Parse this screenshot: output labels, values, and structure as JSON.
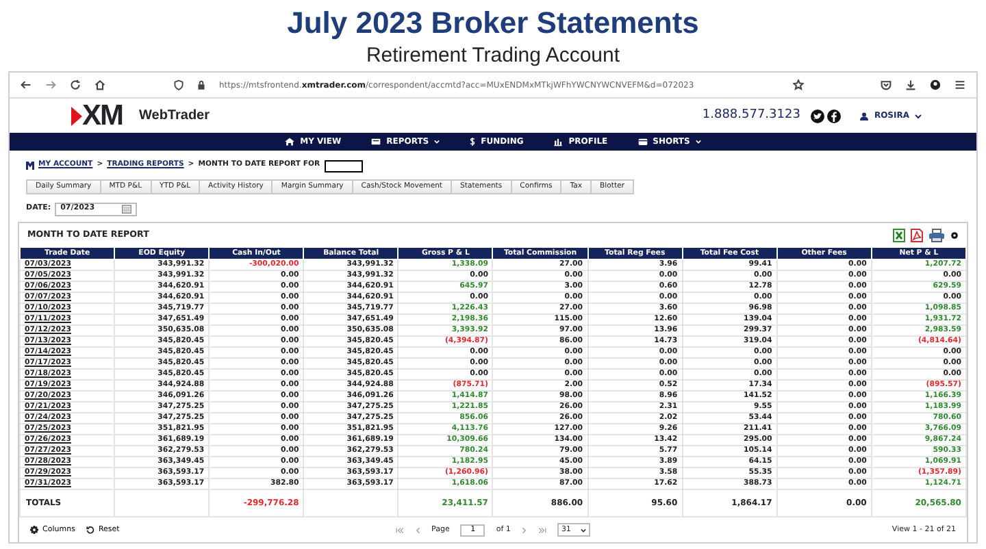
{
  "page": {
    "title": "July 2023 Broker Statements",
    "subtitle": "Retirement Trading Account"
  },
  "browser": {
    "url": "https://mtsfrontend.**xmtrader.com**/correspondent/accmtd?acc=MUxENDMxMTkjWFhYWCNYWCNVEFM&d=072023"
  },
  "header": {
    "logo": "XM",
    "brand": "WebTrader",
    "phone": "1.888.577.3123",
    "user": "ROSIRA"
  },
  "nav": [
    {
      "label": "MY VIEW",
      "dropdown": false
    },
    {
      "label": "REPORTS",
      "dropdown": true
    },
    {
      "label": "FUNDING",
      "dropdown": false
    },
    {
      "label": "PROFILE",
      "dropdown": false
    },
    {
      "label": "SHORTS",
      "dropdown": true
    }
  ],
  "breadcrumb": [
    {
      "kind": "link",
      "text": "MY ACCOUNT"
    },
    {
      "kind": "sep",
      "text": ">"
    },
    {
      "kind": "link",
      "text": "TRADING REPORTS"
    },
    {
      "kind": "sep",
      "text": ">"
    },
    {
      "kind": "current",
      "text": "MONTH TO DATE REPORT FOR"
    }
  ],
  "report_tabs": [
    "Daily Summary",
    "MTD P&L",
    "YTD P&L",
    "Activity History",
    "Margin Summary",
    "Cash/Stock Movement",
    "Statements",
    "Confirms",
    "Tax",
    "Blotter"
  ],
  "date": {
    "label": "DATE:",
    "value": "07/2023"
  },
  "report": {
    "title": "MONTH TO DATE REPORT",
    "columns": [
      "Trade Date",
      "EOD Equity",
      "Cash In/Out",
      "Balance Total",
      "Gross P & L",
      "Total Commission",
      "Total Reg Fees",
      "Total Fee Cost",
      "Other Fees",
      "Net P & L"
    ],
    "rows": [
      {
        "cells": [
          "07/03/2023",
          "343,991.32",
          "-300,020.00",
          "343,991.32",
          "1,338.09",
          "27.00",
          "3.96",
          "99.41",
          "0.00",
          "1,207.72"
        ],
        "cash_negative": true,
        "pnl_gain": true,
        "pnl_loss": false
      },
      {
        "cells": [
          "07/05/2023",
          "343,991.32",
          "0.00",
          "343,991.32",
          "0.00",
          "0.00",
          "0.00",
          "0.00",
          "0.00",
          "0.00"
        ],
        "cash_negative": false,
        "pnl_gain": false,
        "pnl_loss": false
      },
      {
        "cells": [
          "07/06/2023",
          "344,620.91",
          "0.00",
          "344,620.91",
          "645.97",
          "3.00",
          "0.60",
          "12.78",
          "0.00",
          "629.59"
        ],
        "cash_negative": false,
        "pnl_gain": true,
        "pnl_loss": false
      },
      {
        "cells": [
          "07/07/2023",
          "344,620.91",
          "0.00",
          "344,620.91",
          "0.00",
          "0.00",
          "0.00",
          "0.00",
          "0.00",
          "0.00"
        ],
        "cash_negative": false,
        "pnl_gain": false,
        "pnl_loss": false
      },
      {
        "cells": [
          "07/10/2023",
          "345,719.77",
          "0.00",
          "345,719.77",
          "1,226.43",
          "27.00",
          "3.60",
          "96.98",
          "0.00",
          "1,098.85"
        ],
        "cash_negative": false,
        "pnl_gain": true,
        "pnl_loss": false
      },
      {
        "cells": [
          "07/11/2023",
          "347,651.49",
          "0.00",
          "347,651.49",
          "2,198.36",
          "115.00",
          "12.60",
          "139.04",
          "0.00",
          "1,931.72"
        ],
        "cash_negative": false,
        "pnl_gain": true,
        "pnl_loss": false
      },
      {
        "cells": [
          "07/12/2023",
          "350,635.08",
          "0.00",
          "350,635.08",
          "3,393.92",
          "97.00",
          "13.96",
          "299.37",
          "0.00",
          "2,983.59"
        ],
        "cash_negative": false,
        "pnl_gain": true,
        "pnl_loss": false
      },
      {
        "cells": [
          "07/13/2023",
          "345,820.45",
          "0.00",
          "345,820.45",
          "(4,394.87)",
          "86.00",
          "14.73",
          "319.04",
          "0.00",
          "(4,814.64)"
        ],
        "cash_negative": false,
        "pnl_gain": false,
        "pnl_loss": true
      },
      {
        "cells": [
          "07/14/2023",
          "345,820.45",
          "0.00",
          "345,820.45",
          "0.00",
          "0.00",
          "0.00",
          "0.00",
          "0.00",
          "0.00"
        ],
        "cash_negative": false,
        "pnl_gain": false,
        "pnl_loss": false
      },
      {
        "cells": [
          "07/17/2023",
          "345,820.45",
          "0.00",
          "345,820.45",
          "0.00",
          "0.00",
          "0.00",
          "0.00",
          "0.00",
          "0.00"
        ],
        "cash_negative": false,
        "pnl_gain": false,
        "pnl_loss": false
      },
      {
        "cells": [
          "07/18/2023",
          "345,820.45",
          "0.00",
          "345,820.45",
          "0.00",
          "0.00",
          "0.00",
          "0.00",
          "0.00",
          "0.00"
        ],
        "cash_negative": false,
        "pnl_gain": false,
        "pnl_loss": false
      },
      {
        "cells": [
          "07/19/2023",
          "344,924.88",
          "0.00",
          "344,924.88",
          "(875.71)",
          "2.00",
          "0.52",
          "17.34",
          "0.00",
          "(895.57)"
        ],
        "cash_negative": false,
        "pnl_gain": false,
        "pnl_loss": true
      },
      {
        "cells": [
          "07/20/2023",
          "346,091.26",
          "0.00",
          "346,091.26",
          "1,414.87",
          "98.00",
          "8.96",
          "141.52",
          "0.00",
          "1,166.39"
        ],
        "cash_negative": false,
        "pnl_gain": true,
        "pnl_loss": false
      },
      {
        "cells": [
          "07/21/2023",
          "347,275.25",
          "0.00",
          "347,275.25",
          "1,221.85",
          "26.00",
          "2.31",
          "9.55",
          "0.00",
          "1,183.99"
        ],
        "cash_negative": false,
        "pnl_gain": true,
        "pnl_loss": false
      },
      {
        "cells": [
          "07/24/2023",
          "347,275.25",
          "0.00",
          "347,275.25",
          "856.06",
          "26.00",
          "2.02",
          "53.44",
          "0.00",
          "780.60"
        ],
        "cash_negative": false,
        "pnl_gain": true,
        "pnl_loss": false
      },
      {
        "cells": [
          "07/25/2023",
          "351,821.95",
          "0.00",
          "351,821.95",
          "4,113.76",
          "127.00",
          "9.26",
          "211.41",
          "0.00",
          "3,766.09"
        ],
        "cash_negative": false,
        "pnl_gain": true,
        "pnl_loss": false
      },
      {
        "cells": [
          "07/26/2023",
          "361,689.19",
          "0.00",
          "361,689.19",
          "10,309.66",
          "134.00",
          "13.42",
          "295.00",
          "0.00",
          "9,867.24"
        ],
        "cash_negative": false,
        "pnl_gain": true,
        "pnl_loss": false
      },
      {
        "cells": [
          "07/27/2023",
          "362,279.53",
          "0.00",
          "362,279.53",
          "780.24",
          "79.00",
          "5.77",
          "105.14",
          "0.00",
          "590.33"
        ],
        "cash_negative": false,
        "pnl_gain": true,
        "pnl_loss": false
      },
      {
        "cells": [
          "07/28/2023",
          "363,349.45",
          "0.00",
          "363,349.45",
          "1,182.95",
          "45.00",
          "3.89",
          "64.15",
          "0.00",
          "1,069.91"
        ],
        "cash_negative": false,
        "pnl_gain": true,
        "pnl_loss": false
      },
      {
        "cells": [
          "07/29/2023",
          "363,593.17",
          "0.00",
          "363,593.17",
          "(1,260.96)",
          "38.00",
          "3.58",
          "55.35",
          "0.00",
          "(1,357.89)"
        ],
        "cash_negative": false,
        "pnl_gain": false,
        "pnl_loss": true
      },
      {
        "cells": [
          "07/31/2023",
          "363,593.17",
          "382.80",
          "363,593.17",
          "1,618.06",
          "87.00",
          "17.62",
          "388.73",
          "0.00",
          "1,124.71"
        ],
        "cash_negative": false,
        "pnl_gain": true,
        "pnl_loss": false
      }
    ],
    "totals": {
      "cells": [
        "TOTALS",
        "",
        "-299,776.28",
        "",
        "23,411.57",
        "886.00",
        "95.60",
        "1,864.17",
        "0.00",
        "20,565.80"
      ],
      "cash_negative": true,
      "pnl_gain": true,
      "pnl_loss": false
    }
  },
  "footer": {
    "columns": "Columns",
    "reset": "Reset",
    "page_label": "Page",
    "page": "1",
    "of": "of 1",
    "page_size": "31",
    "view": "View 1 - 21 of 21"
  }
}
